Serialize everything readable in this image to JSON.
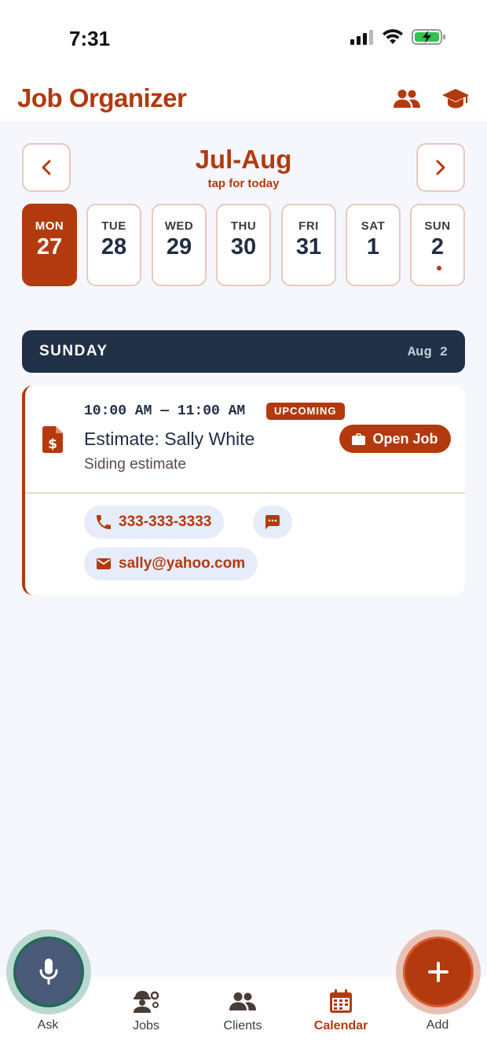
{
  "status": {
    "time": "7:31"
  },
  "header": {
    "title": "Job Organizer",
    "icons": [
      "people-icon",
      "graduation-cap-icon"
    ]
  },
  "calendar": {
    "range_title": "Jul-Aug",
    "range_subtitle": "tap for today",
    "days": [
      {
        "name": "MON",
        "num": "27",
        "active": true,
        "has_event": false
      },
      {
        "name": "TUE",
        "num": "28",
        "active": false,
        "has_event": false
      },
      {
        "name": "WED",
        "num": "29",
        "active": false,
        "has_event": false
      },
      {
        "name": "THU",
        "num": "30",
        "active": false,
        "has_event": false
      },
      {
        "name": "FRI",
        "num": "31",
        "active": false,
        "has_event": false
      },
      {
        "name": "SAT",
        "num": "1",
        "active": false,
        "has_event": false
      },
      {
        "name": "SUN",
        "num": "2",
        "active": false,
        "has_event": true
      }
    ]
  },
  "section": {
    "title": "SUNDAY",
    "date": "Aug 2"
  },
  "event": {
    "time": "10:00 AM — 11:00 AM",
    "badge": "UPCOMING",
    "title": "Estimate: Sally White",
    "subtitle": "Siding estimate",
    "open_label": "Open Job",
    "phone": "333-333-3333",
    "email": "sally@yahoo.com"
  },
  "tabs": {
    "ask": "Ask",
    "jobs": "Jobs",
    "clients": "Clients",
    "calendar": "Calendar",
    "add": "Add"
  },
  "colors": {
    "brand": "#b23a0e",
    "navy": "#1f3047",
    "chip_bg": "#e6ecf9"
  }
}
